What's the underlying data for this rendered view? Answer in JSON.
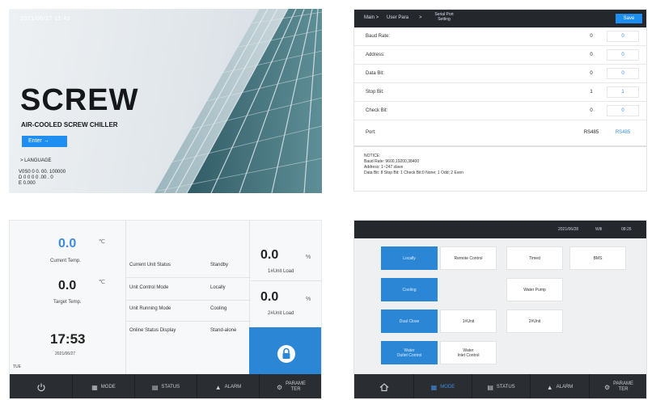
{
  "splash": {
    "datetime": "2021/06/27  11:43",
    "title": "SCREW",
    "subtitle": "AIR-COOLED SCREW CHILLER",
    "enter_label": "Enter  →",
    "language_label": "> LANGUAGE",
    "version_lines": [
      "V0S0 0 0. 00. 100000",
      "D  0 0 0 0 .00 . 0",
      "E  0.000"
    ]
  },
  "serial": {
    "breadcrumb": [
      "Main >",
      "User Para",
      ">"
    ],
    "breadcrumb_current": [
      "Serial Port",
      "Setting"
    ],
    "save_label": "Save",
    "rows": [
      {
        "label": "Baud Rate:",
        "value": "0",
        "input": "0"
      },
      {
        "label": "Address:",
        "value": "0",
        "input": "0"
      },
      {
        "label": "Data Bit:",
        "value": "0",
        "input": "0"
      },
      {
        "label": "Stop Bit:",
        "value": "1",
        "input": "1"
      },
      {
        "label": "Check Bit:",
        "value": "0",
        "input": "0"
      },
      {
        "label": "Port:",
        "value": "RS485",
        "input": "RS485"
      }
    ],
    "notice": [
      "NOTICE:",
      "Baud Rate: 9600,19200,38400",
      "Address: 1~247 slave",
      "Data Bit: 8  Stop Bit: 1  Check Bit:0 None;  1 Odd;  2 Even"
    ]
  },
  "status": {
    "current_temp_value": "0.0",
    "current_temp_label": "Current Temp.",
    "target_temp_value": "0.0",
    "target_temp_label": "Target Temp.",
    "unit": "℃",
    "time": "17:53",
    "date": "2021/06/27",
    "weekday": "TUE",
    "rows": [
      {
        "label": "Current Unit Status",
        "value": "Standby"
      },
      {
        "label": "Unit Control Mode",
        "value": "Locally"
      },
      {
        "label": "Unit Running Mode",
        "value": "Cooling"
      },
      {
        "label": "Online Status Display",
        "value": "Stand-alone"
      }
    ],
    "load1_value": "0.0",
    "load1_label": "1#Unit Load",
    "load2_value": "0.0",
    "load2_label": "2#Unit Load",
    "percent": "%"
  },
  "mode": {
    "topbar": {
      "date": "2021/06/28",
      "wifi": "Wifi",
      "time": "08:26"
    },
    "buttons": {
      "locally": "Locally",
      "remote": "Remote Control",
      "timed": "Timed",
      "bms": "BMS",
      "cooling": "Cooling",
      "water_pump": "Water Pump",
      "dual_close": "Dual Close",
      "unit1": "1#Unit",
      "unit2": "2#Unit",
      "water_outlet": [
        "Water",
        "Outlet Control"
      ],
      "water_inlet": [
        "Water",
        "Inlet Control"
      ]
    }
  },
  "nav": {
    "mode": "MODE",
    "status": "STATUS",
    "alarm": "ALARM",
    "param": [
      "PARAME",
      "TER"
    ]
  },
  "colors": {
    "accent": "#2b86d6",
    "navbar": "#2a2d31",
    "header": "#24282d"
  }
}
